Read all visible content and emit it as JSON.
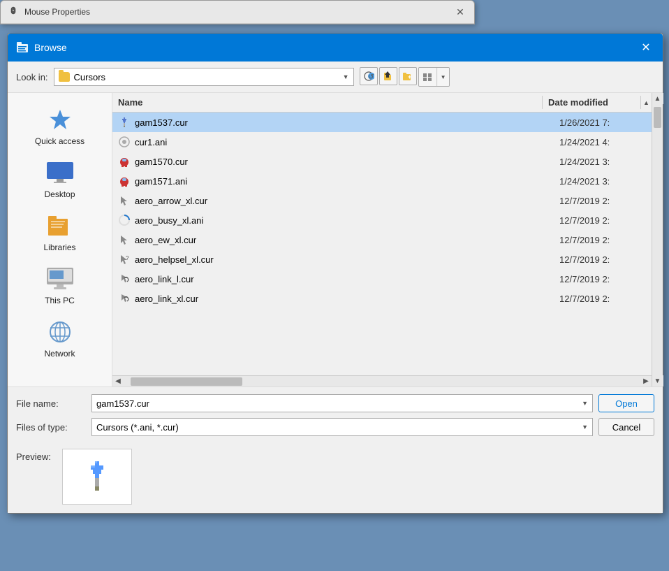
{
  "mouseProps": {
    "title": "Mouse Properties",
    "closeBtn": "✕"
  },
  "browse": {
    "title": "Browse",
    "closeBtn": "✕",
    "toolbar": {
      "lookInLabel": "Look in:",
      "currentFolder": "Cursors",
      "backBtn": "←",
      "upBtn": "↑",
      "newFolderBtn": "📁",
      "viewBtn": "⊞",
      "viewDropBtn": "▼"
    },
    "sidebar": {
      "items": [
        {
          "id": "quick-access",
          "label": "Quick access"
        },
        {
          "id": "desktop",
          "label": "Desktop"
        },
        {
          "id": "libraries",
          "label": "Libraries"
        },
        {
          "id": "this-pc",
          "label": "This PC"
        },
        {
          "id": "network",
          "label": "Network"
        }
      ]
    },
    "fileList": {
      "columns": [
        {
          "id": "name",
          "label": "Name"
        },
        {
          "id": "date",
          "label": "Date modified"
        }
      ],
      "files": [
        {
          "name": "gam1537.cur",
          "date": "1/26/2021 7:",
          "selected": true,
          "type": "cur",
          "iconColor": "#5577cc"
        },
        {
          "name": "cur1.ani",
          "date": "1/24/2021 4:",
          "selected": false,
          "type": "ani",
          "iconColor": "#8899aa"
        },
        {
          "name": "gam1570.cur",
          "date": "1/24/2021 3:",
          "selected": false,
          "type": "cur",
          "iconColor": "#cc3333"
        },
        {
          "name": "gam1571.ani",
          "date": "1/24/2021 3:",
          "selected": false,
          "type": "ani",
          "iconColor": "#cc3333"
        },
        {
          "name": "aero_arrow_xl.cur",
          "date": "12/7/2019 2:",
          "selected": false,
          "type": "cur",
          "iconColor": "#888888"
        },
        {
          "name": "aero_busy_xl.ani",
          "date": "12/7/2019 2:",
          "selected": false,
          "type": "ani",
          "iconColor": "#2277cc"
        },
        {
          "name": "aero_ew_xl.cur",
          "date": "12/7/2019 2:",
          "selected": false,
          "type": "cur",
          "iconColor": "#888888"
        },
        {
          "name": "aero_helpsel_xl.cur",
          "date": "12/7/2019 2:",
          "selected": false,
          "type": "cur",
          "iconColor": "#888888"
        },
        {
          "name": "aero_link_l.cur",
          "date": "12/7/2019 2:",
          "selected": false,
          "type": "cur",
          "iconColor": "#888888"
        },
        {
          "name": "aero_link_xl.cur",
          "date": "12/7/2019 2:",
          "selected": false,
          "type": "cur",
          "iconColor": "#888888"
        }
      ]
    },
    "bottom": {
      "fileNameLabel": "File name:",
      "fileNameValue": "gam1537.cur",
      "filesOfTypeLabel": "Files of type:",
      "filesOfTypeValue": "Cursors (*.ani, *.cur)",
      "openBtn": "Open",
      "cancelBtn": "Cancel"
    },
    "preview": {
      "label": "Preview:"
    }
  }
}
